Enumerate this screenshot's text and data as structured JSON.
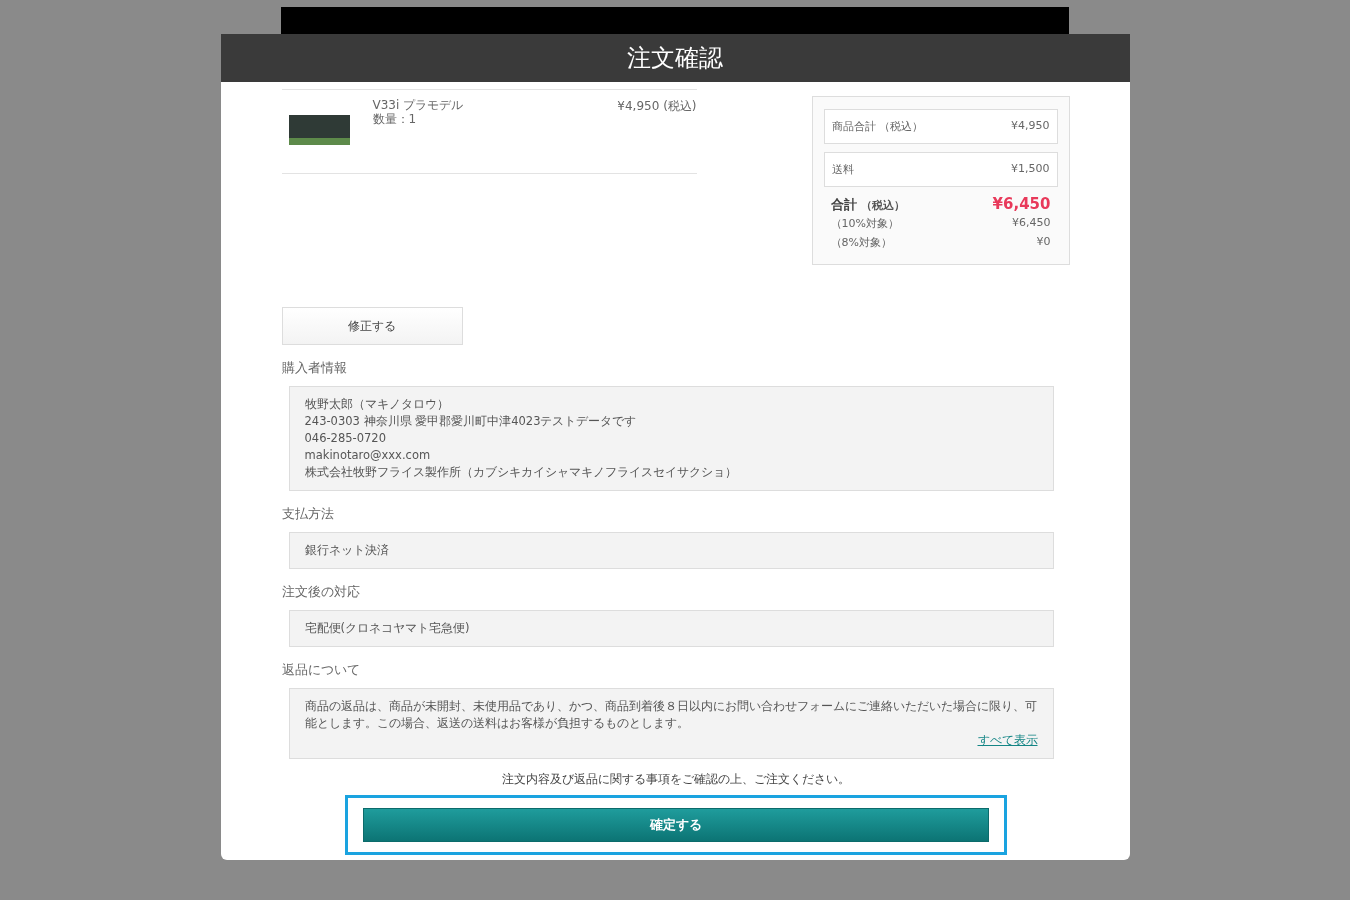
{
  "dialog": {
    "title": "注文確認"
  },
  "items": [
    {
      "name": "V33i プラモデル",
      "quantity": "数量：1",
      "price": "¥4,950 (税込)"
    }
  ],
  "summary": {
    "rows": [
      {
        "label": "商品合計 （税込）",
        "value": "¥4,950"
      },
      {
        "label": "送料",
        "value": "¥1,500"
      }
    ],
    "total": {
      "label": "合計",
      "note": "（税込）",
      "value": "¥6,450"
    },
    "breakdown": [
      {
        "label": "（10%対象）",
        "value": "¥6,450"
      },
      {
        "label": "（8%対象）",
        "value": "¥0"
      }
    ]
  },
  "edit_button": "修正する",
  "sections": [
    {
      "heading": "購入者情報",
      "lines": [
        "牧野太郎（マキノタロウ）",
        "243-0303 神奈川県 愛甲郡愛川町中津4023テストデータです",
        "046-285-0720",
        "makinotaro@xxx.com",
        "株式会社牧野フライス製作所（カブシキカイシャマキノフライスセイサクショ）"
      ]
    },
    {
      "heading": "支払方法",
      "lines": [
        "銀行ネット決済"
      ]
    },
    {
      "heading": "注文後の対応",
      "lines": [
        "宅配便(クロネコヤマト宅急便)"
      ]
    },
    {
      "heading": "返品について",
      "lines": [
        "商品の返品は、商品が未開封、未使用品であり、かつ、商品到着後８日以内にお問い合わせフォームにご連絡いただいた場合に限り、可能とします。この場合、返送の送料はお客様が負担するものとします。"
      ],
      "link": "すべて表示"
    }
  ],
  "notice": "注文内容及び返品に関する事項をご確認の上、ご注文ください。",
  "confirm_button": "確定する"
}
